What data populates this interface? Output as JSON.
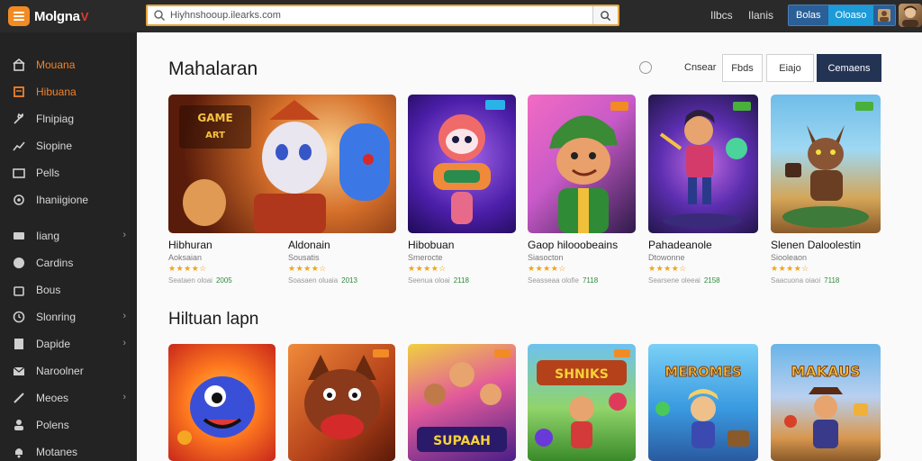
{
  "app": {
    "name": "Molgna",
    "logo_mark": "V"
  },
  "search": {
    "placeholder": "Hiyhnshooup.ilearks.com",
    "value": "Hiyhnshooup.ilearks.com"
  },
  "topnav": {
    "link1": "Ilbcs",
    "link2": "Ilanis",
    "btn1": "Bolas",
    "btn2": "Oloaso"
  },
  "sidebar": {
    "items": [
      {
        "label": "Mouana",
        "icon": "home-icon",
        "accent": true
      },
      {
        "label": "Hibuana",
        "icon": "book-icon",
        "active": true
      },
      {
        "label": "Flnipiag",
        "icon": "wrench-icon"
      },
      {
        "label": "Siopine",
        "icon": "chart-icon"
      },
      {
        "label": "Pells",
        "icon": "folder-icon"
      },
      {
        "label": "Ihaniigione",
        "icon": "gear-icon"
      },
      {
        "label": "Iiang",
        "icon": "card-icon",
        "chevron": true
      },
      {
        "label": "Cardins",
        "icon": "user-icon"
      },
      {
        "label": "Bous",
        "icon": "bag-icon"
      },
      {
        "label": "Slonring",
        "icon": "clock-icon",
        "chevron": true
      },
      {
        "label": "Dapide",
        "icon": "doc-icon",
        "chevron": true
      },
      {
        "label": "Naroolner",
        "icon": "mail-icon"
      },
      {
        "label": "Meoes",
        "icon": "tool-icon",
        "chevron": true
      },
      {
        "label": "Polens",
        "icon": "person-icon"
      },
      {
        "label": "Motanes",
        "icon": "bell-icon"
      }
    ]
  },
  "main": {
    "section1_title": "Mahalaran",
    "section2_title": "Hiltuan lapn",
    "sort_label": "Cnsear",
    "filters": [
      "Fbds",
      "Eiajo",
      "Cemaens"
    ],
    "row1": [
      {
        "title": "Hibhuran",
        "sub": "Aoksaian",
        "rating": 4.5,
        "meta": "Seataen oloai",
        "num": "2005"
      },
      {
        "title": "Aldonain",
        "sub": "Sousatis",
        "rating": 4.5,
        "meta": "Soasaen oluaia",
        "num": "2013"
      },
      {
        "title": "Hibobuan",
        "sub": "Smerocte",
        "rating": 4.5,
        "meta": "Seenua oloai",
        "num": "2118"
      },
      {
        "title": "Gaop hilooobeains",
        "sub": "Siasocton",
        "rating": 4.5,
        "meta": "Seasseaa olofie",
        "num": "7118"
      },
      {
        "title": "Pahadeanole",
        "sub": "Dtowonne",
        "rating": 4.5,
        "meta": "Searsene oleeai",
        "num": "2158"
      },
      {
        "title": "Slenen Daloolestin",
        "sub": "Siooleaon",
        "rating": 4.5,
        "meta": "Saacuona oiaoi",
        "num": "7118"
      }
    ],
    "row2_art": [
      "SUPAAH",
      "SHNIKS",
      "MEROMES",
      "MAKAUS"
    ]
  },
  "colors": {
    "accent": "#f2822a",
    "brand_dark": "#233354",
    "search_border": "#e3a73a"
  }
}
